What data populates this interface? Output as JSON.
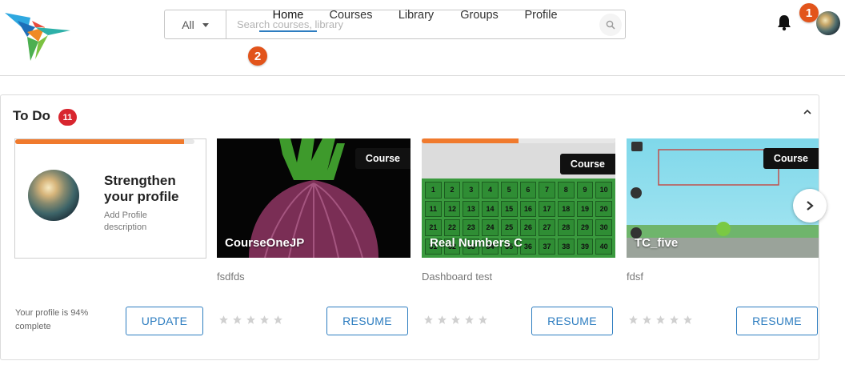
{
  "header": {
    "search": {
      "scope": "All",
      "placeholder": "Search courses, library"
    },
    "badges": {
      "notifications_step": "1",
      "nav_step": "2"
    }
  },
  "nav": {
    "tabs": [
      {
        "label": "Home",
        "active": true
      },
      {
        "label": "Courses",
        "active": false
      },
      {
        "label": "Library",
        "active": false
      },
      {
        "label": "Groups",
        "active": false
      },
      {
        "label": "Profile",
        "active": false
      }
    ]
  },
  "todo": {
    "title": "To Do",
    "count": "11",
    "profile_card": {
      "title": "Strengthen your profile",
      "subtitle": "Add Profile description",
      "completion_text": "Your profile is 94% complete",
      "completion": 0.94,
      "button": "UPDATE"
    },
    "courses": [
      {
        "tag": "Course",
        "name": "CourseOneJP",
        "description": "fsdfds",
        "button": "RESUME",
        "rating": 0
      },
      {
        "tag": "Course",
        "name": "Real Numbers C",
        "description": "Dashboard test",
        "button": "RESUME",
        "rating": 0,
        "progress": 0.5
      },
      {
        "tag": "Course",
        "name": "TC_five",
        "description": "fdsf",
        "button": "RESUME",
        "rating": 0
      }
    ],
    "grid_numbers": [
      "1",
      "2",
      "3",
      "4",
      "5",
      "6",
      "7",
      "8",
      "9",
      "10",
      "11",
      "12",
      "13",
      "14",
      "15",
      "16",
      "17",
      "18",
      "19",
      "20",
      "21",
      "22",
      "23",
      "24",
      "25",
      "26",
      "27",
      "28",
      "29",
      "30",
      "31",
      "32",
      "33",
      "34",
      "35",
      "36",
      "37",
      "38",
      "39",
      "40"
    ]
  },
  "colors": {
    "accent": "#2d7dc0",
    "orange": "#e2541b",
    "progress": "#f07a2d",
    "count_badge": "#d8262f"
  }
}
